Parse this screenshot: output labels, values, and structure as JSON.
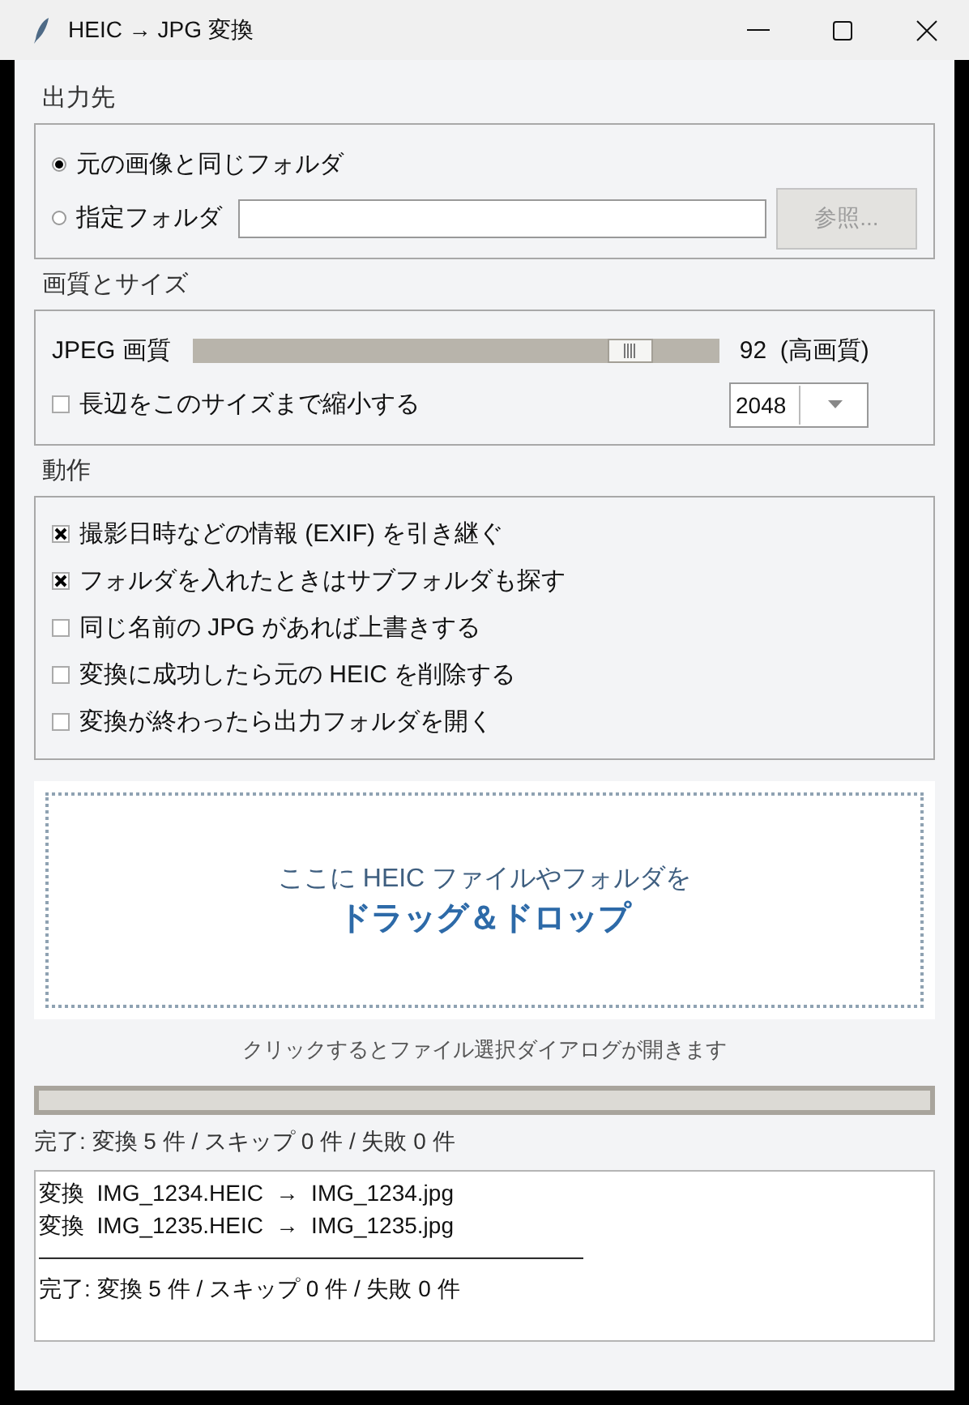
{
  "window": {
    "title": "HEIC → JPG 変換"
  },
  "output": {
    "heading": "出力先",
    "options": [
      {
        "label": "元の画像と同じフォルダ",
        "selected": true
      },
      {
        "label": "指定フォルダ",
        "selected": false
      }
    ],
    "browse_button": {
      "label": "参照...",
      "disabled": true
    }
  },
  "quality": {
    "heading": "画質とサイズ",
    "slider_label": "JPEG 画質",
    "level": 0.83,
    "reading": "92  (高画質)",
    "resize": {
      "label": "長辺をこのサイズまで縮小する",
      "checked": false
    },
    "size_select": {
      "value": "2048"
    }
  },
  "actions": {
    "heading": "動作",
    "options": [
      {
        "label": "撮影日時などの情報 (EXIF) を引き継ぐ",
        "checked": true
      },
      {
        "label": "フォルダを入れたときはサブフォルダも探す",
        "checked": true
      },
      {
        "label": "同じ名前の JPG があれば上書きする",
        "checked": false
      },
      {
        "label": "変換に成功したら元の HEIC を削除する",
        "checked": false
      },
      {
        "label": "変換が終わったら出力フォルダを開く",
        "checked": false
      }
    ]
  },
  "drop_zone": {
    "line1": "ここに HEIC ファイルやフォルダを",
    "line2": "ドラッグ＆ドロップ"
  },
  "hint": "クリックするとファイル選択ダイアログが開きます",
  "progress": {
    "level": 0
  },
  "status": "完了: 変換 5 件 / スキップ 0 件 / 失敗 0 件",
  "log": [
    "変換  IMG_1234.HEIC  →  IMG_1234.jpg",
    "変換  IMG_1235.HEIC  →  IMG_1235.jpg",
    "————————————————————————",
    "完了: 変換 5 件 / スキップ 0 件 / 失敗 0 件"
  ]
}
